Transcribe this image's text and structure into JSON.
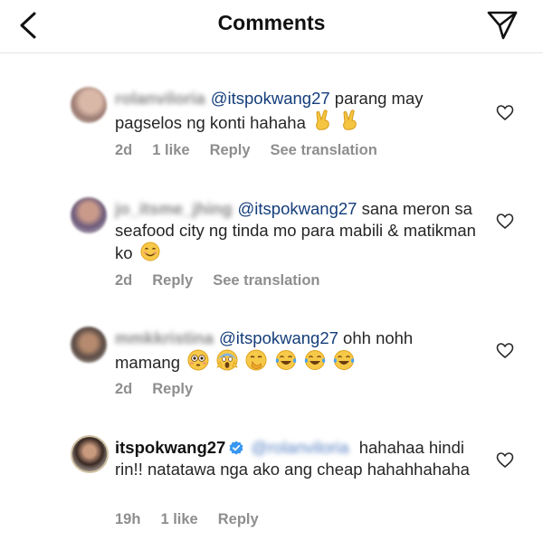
{
  "header": {
    "title": "Comments",
    "back_icon": "chevron-left-icon",
    "share_icon": "paper-plane-icon"
  },
  "comments": [
    {
      "username": "rolanviloria",
      "mention": "@itspokwang27",
      "text": " parang may pagselos ng konti hahaha",
      "emojis": [
        "victory-hand",
        "victory-hand"
      ],
      "time": "2d",
      "likes": "1 like",
      "reply": "Reply",
      "translate": "See translation"
    },
    {
      "username": "jo_itsme_jhing",
      "mention": "@itspokwang27",
      "text": " sana meron sa seafood city ng tinda mo para mabili & matikman ko",
      "emojis": [
        "smiling-face"
      ],
      "time": "2d",
      "reply": "Reply",
      "translate": "See translation"
    },
    {
      "username": "mmkkristina",
      "mention": "@itspokwang27",
      "text": " ohh nohh mamang",
      "emojis": [
        "flushed-face",
        "screaming-face",
        "hand-over-mouth-face",
        "tears-of-joy-face",
        "tears-of-joy-face",
        "tears-of-joy-face"
      ],
      "time": "2d",
      "reply": "Reply"
    },
    {
      "username": "itspokwang27",
      "verified": true,
      "mention": "@rolanviloria",
      "text": " hahahaa hindi rin!! natatawa nga ako ang cheap hahahhahaha",
      "time": "19h",
      "likes": "1 like",
      "reply": "Reply"
    }
  ],
  "colors": {
    "mention": "#143d7a",
    "meta": "#8e8e8e",
    "verified": "#3897f0"
  }
}
